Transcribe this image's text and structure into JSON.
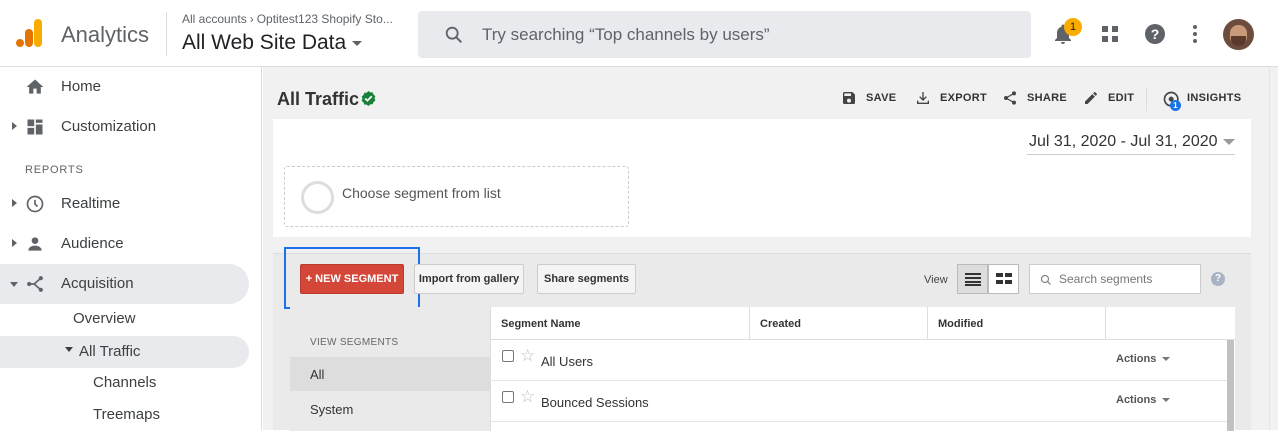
{
  "header": {
    "app_name": "Analytics",
    "breadcrumb": {
      "account": "All accounts",
      "separator": "›",
      "property": "Optitest123 Shopify Sto..."
    },
    "view_name": "All Web Site Data",
    "search_placeholder": "Try searching “Top channels by users”",
    "notification_count": "1"
  },
  "sidebar": {
    "items": [
      {
        "label": "Home",
        "icon": "home-icon"
      },
      {
        "label": "Customization",
        "icon": "customization-icon"
      }
    ],
    "reports_label": "REPORTS",
    "reports": [
      {
        "label": "Realtime",
        "icon": "clock-icon"
      },
      {
        "label": "Audience",
        "icon": "person-icon"
      },
      {
        "label": "Acquisition",
        "icon": "acquisition-icon"
      }
    ],
    "acquisition_sub": {
      "overview": "Overview",
      "all_traffic": "All Traffic",
      "channels": "Channels",
      "treemaps": "Treemaps"
    }
  },
  "report": {
    "title": "All Traffic",
    "toolbar": {
      "save": "SAVE",
      "export": "EXPORT",
      "share": "SHARE",
      "edit": "EDIT",
      "insights": "INSIGHTS",
      "insights_badge": "1"
    },
    "date_range": "Jul 31, 2020 - Jul 31, 2020",
    "segment_placeholder": "Choose segment from list"
  },
  "segments": {
    "new_segment": "+ NEW SEGMENT",
    "import_gallery": "Import from gallery",
    "share_segments": "Share segments",
    "view_label": "View",
    "search_placeholder": "Search segments",
    "help": "?",
    "view_segments_label": "VIEW SEGMENTS",
    "left_items": [
      "All",
      "System"
    ],
    "columns": [
      "Segment Name",
      "Created",
      "Modified"
    ],
    "rows": [
      {
        "name": "All Users",
        "actions": "Actions"
      },
      {
        "name": "Bounced Sessions",
        "actions": "Actions"
      }
    ]
  },
  "colors": {
    "accent_red": "#d44638",
    "highlight_blue": "#1a73e8",
    "ga_orange": "#f9ab00",
    "verified_green": "#188038"
  }
}
